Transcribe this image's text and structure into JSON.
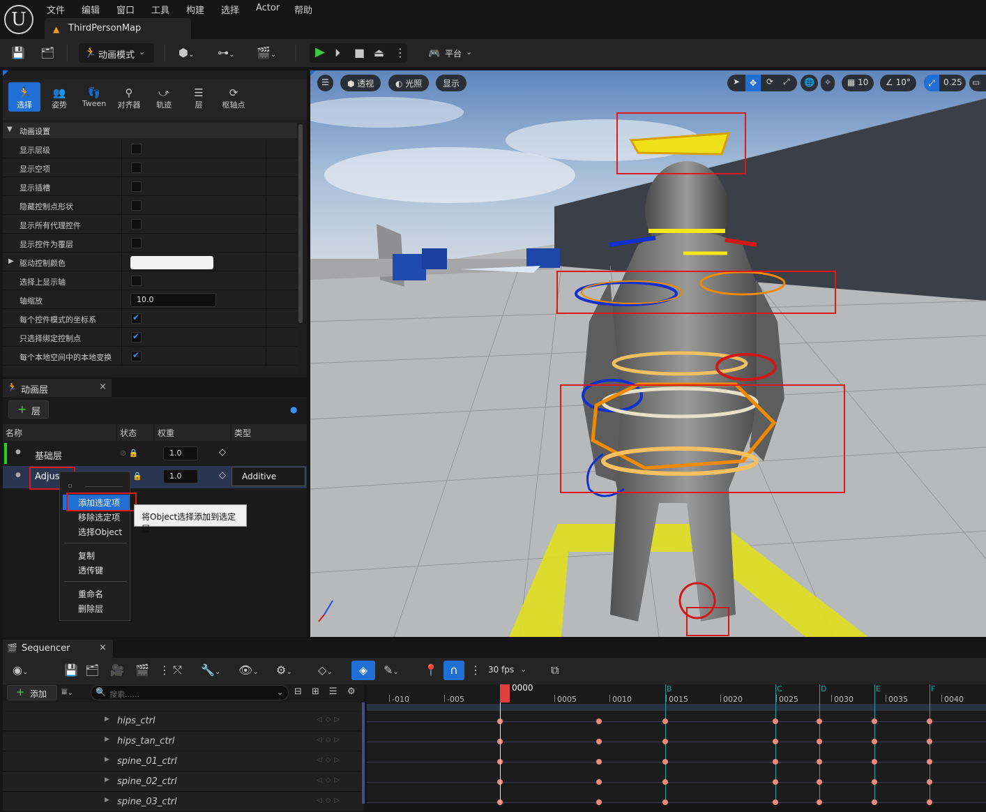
{
  "menubar": {
    "logo": "U",
    "menus": [
      "文件",
      "编辑",
      "窗口",
      "工具",
      "构建",
      "选择",
      "Actor",
      "帮助"
    ],
    "map_tab": "ThirdPersonMap"
  },
  "toolbar": {
    "anim_mode": "动画模式",
    "platform": "平台"
  },
  "modes": [
    {
      "label": "选择",
      "icon": "select-mode-icon",
      "active": true
    },
    {
      "label": "姿势",
      "icon": "pose-icon"
    },
    {
      "label": "Tween",
      "icon": "tween-icon"
    },
    {
      "label": "对齐器",
      "icon": "aligner-icon"
    },
    {
      "label": "轨迹",
      "icon": "trail-icon"
    },
    {
      "label": "层",
      "icon": "layer-icon"
    },
    {
      "label": "枢轴点",
      "icon": "pivot-icon"
    }
  ],
  "anim_settings": {
    "header": "动画设置",
    "rows": [
      {
        "label": "显示层级",
        "type": "check",
        "checked": false
      },
      {
        "label": "显示空项",
        "type": "check",
        "checked": false
      },
      {
        "label": "显示插槽",
        "type": "check",
        "checked": false
      },
      {
        "label": "隐藏控制点形状",
        "type": "check",
        "checked": false
      },
      {
        "label": "显示所有代理控件",
        "type": "check",
        "checked": false
      },
      {
        "label": "显示控件为覆层",
        "type": "check",
        "checked": false
      },
      {
        "label": "驱动控制颜色",
        "type": "color"
      },
      {
        "label": "选择上显示轴",
        "type": "check",
        "checked": false
      },
      {
        "label": "轴缩放",
        "type": "number",
        "value": "10.0"
      },
      {
        "label": "每个控件模式的坐标系",
        "type": "check",
        "checked": true
      },
      {
        "label": "只选择绑定控制点",
        "type": "check",
        "checked": true
      },
      {
        "label": "每个本地空间中的本地变换",
        "type": "check",
        "checked": true
      }
    ]
  },
  "layers": {
    "tab": "动画层",
    "add_label": "层",
    "columns": [
      "名称",
      "状态",
      "权重",
      "类型"
    ],
    "rows": [
      {
        "name": "基础层",
        "weight": "1.0",
        "type": ""
      },
      {
        "name": "Adjust",
        "weight": "1.0",
        "type": "Additive"
      }
    ]
  },
  "context_menu": {
    "items": [
      "添加选定项",
      "移除选定项",
      "选择Object",
      "复制",
      "透传键",
      "重命名",
      "删除层"
    ],
    "tooltip": "将Object选择添加到选定层"
  },
  "viewport": {
    "perspective": "透视",
    "lighting": "光照",
    "show": "显示",
    "grid_snap": "10",
    "rot_snap": "10°",
    "scale_snap": "0.25"
  },
  "sequencer": {
    "tab": "Sequencer",
    "add_label": "添加",
    "search_placeholder": "搜索......",
    "fps": "30 fps",
    "current_frame": "0000",
    "ticks": [
      "-010",
      "-005",
      "0005",
      "0010",
      "0015",
      "0020",
      "0025",
      "0030",
      "0035",
      "0040"
    ],
    "markers": [
      "B",
      "C",
      "D",
      "E",
      "F"
    ],
    "tracks": [
      "hips_ctrl",
      "hips_tan_ctrl",
      "spine_01_ctrl",
      "spine_02_ctrl",
      "spine_03_ctrl"
    ]
  }
}
